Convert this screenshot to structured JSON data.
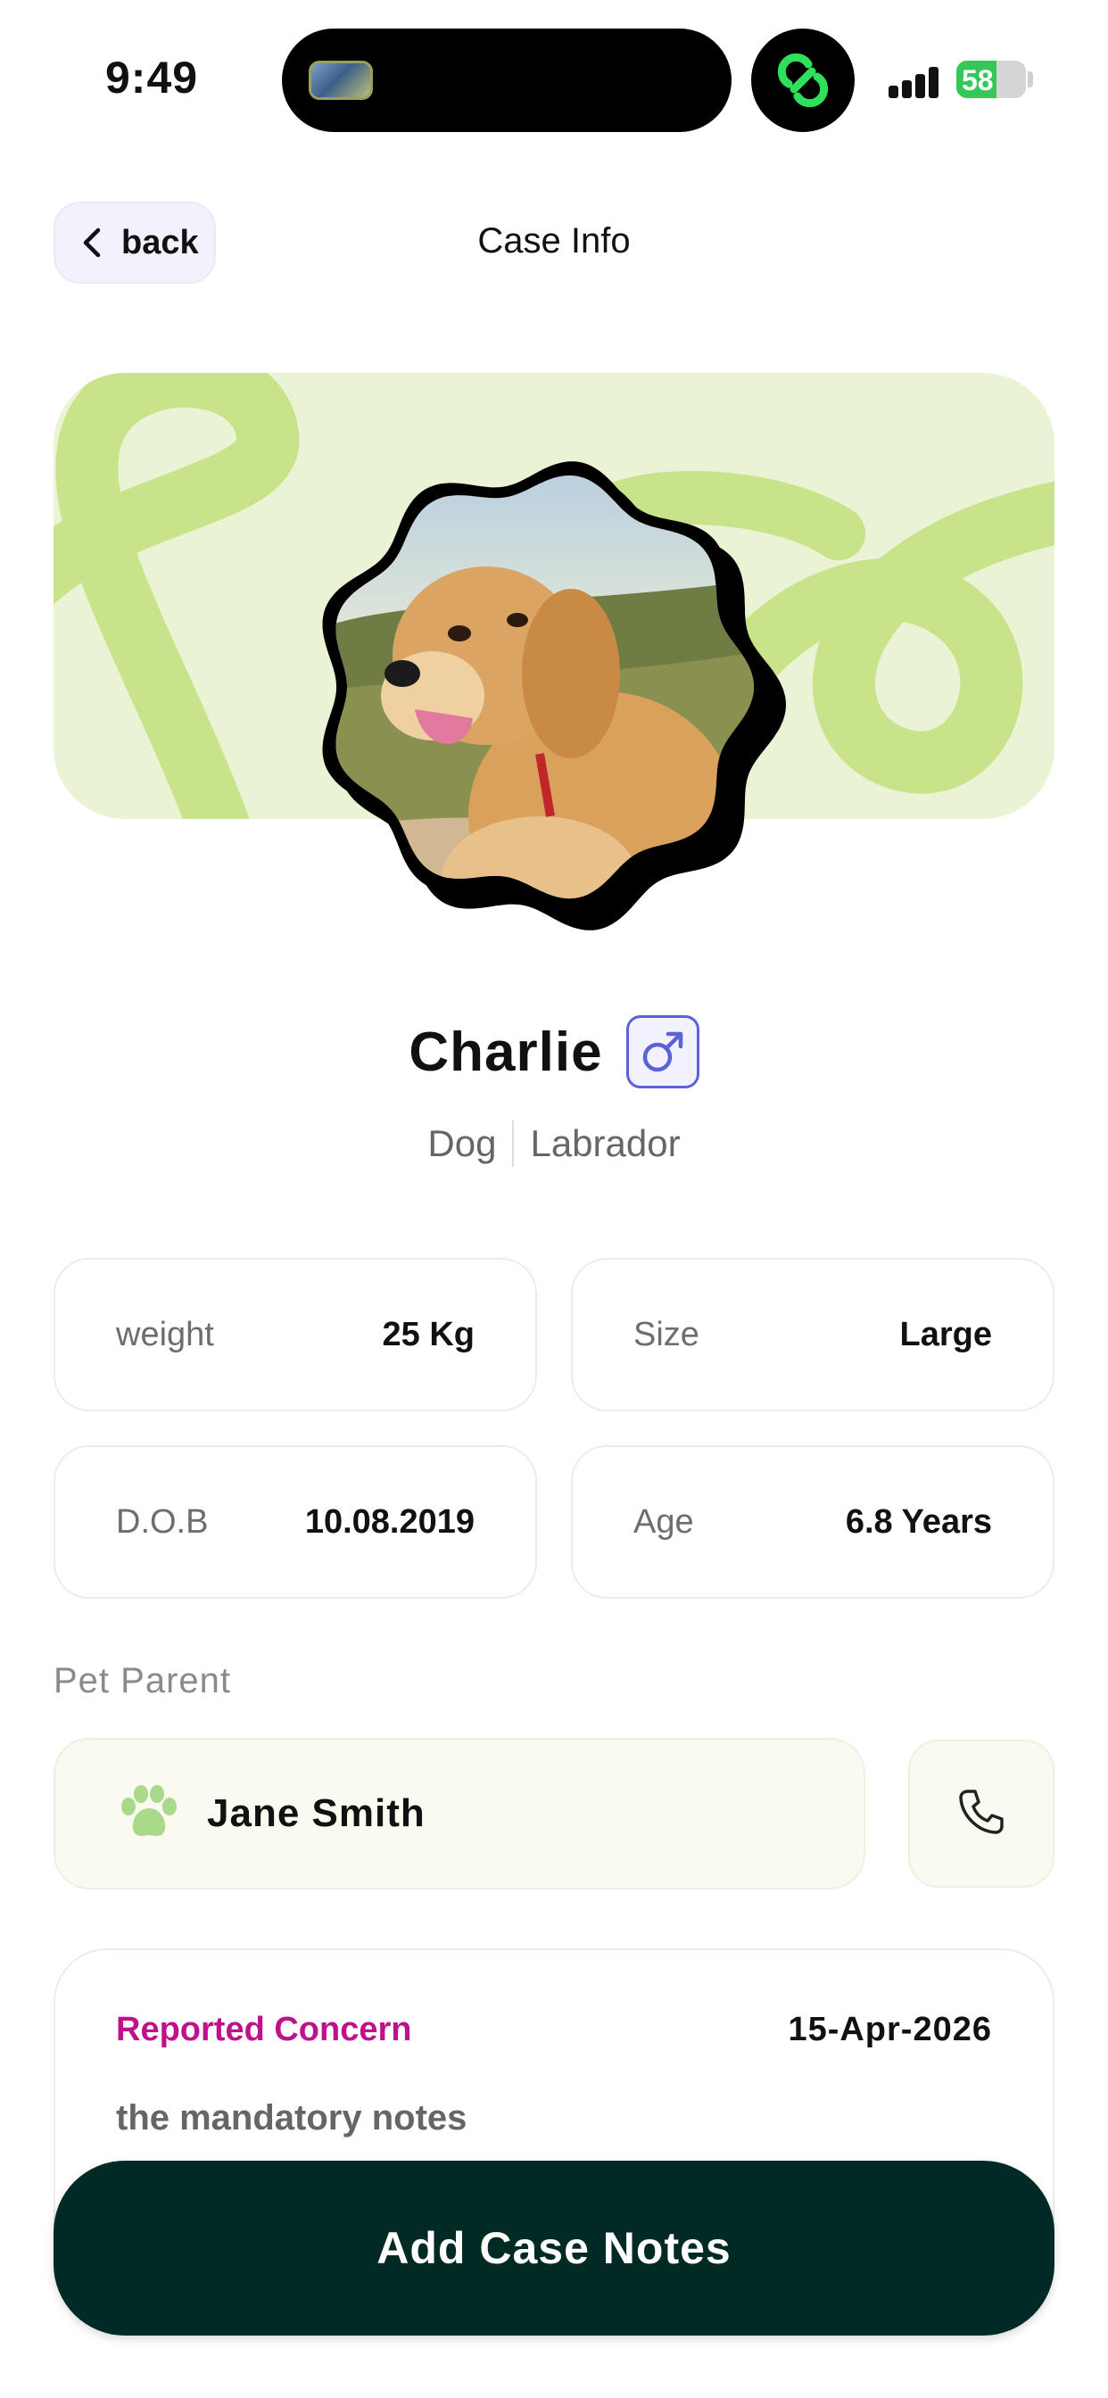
{
  "status_bar": {
    "time": "9:49",
    "battery_percent": "58",
    "battery_level": 0.58
  },
  "header": {
    "back_label": "back",
    "title": "Case Info"
  },
  "pet": {
    "name": "Charlie",
    "gender": "male",
    "species": "Dog",
    "breed": "Labrador"
  },
  "info": [
    {
      "label": "weight",
      "value": "25 Kg"
    },
    {
      "label": "Size",
      "value": "Large"
    },
    {
      "label": "D.O.B",
      "value": "10.08.2019"
    },
    {
      "label": "Age",
      "value": "6.8 Years"
    }
  ],
  "pet_parent": {
    "section_label": "Pet Parent",
    "name": "Jane Smith"
  },
  "concern": {
    "title": "Reported Concern",
    "date": "15-Apr-2026",
    "notes": "the mandatory notes"
  },
  "cta_label": "Add Case Notes",
  "colors": {
    "banner_bg": "#eaf3d4",
    "banner_shapes": "#c8e38a",
    "concern_accent": "#c0118c",
    "cta_bg": "#022a25",
    "gender_accent": "#5b62d6"
  }
}
